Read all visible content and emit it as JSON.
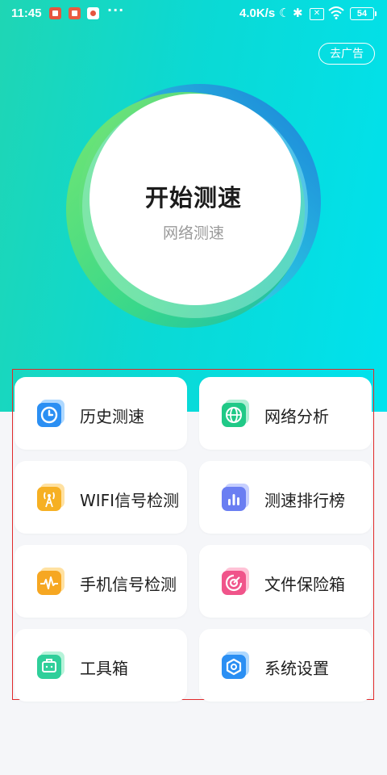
{
  "status_bar": {
    "time": "11:45",
    "dots": "···",
    "net_speed": "4.0K/s",
    "battery": "54"
  },
  "header": {
    "remove_ads": "去广告"
  },
  "speed_test": {
    "title": "开始测速",
    "subtitle": "网络测速"
  },
  "features": [
    {
      "label": "历史测速",
      "icon": "clock-icon",
      "color": "#2b8ff3"
    },
    {
      "label": "网络分析",
      "icon": "globe-icon",
      "color": "#20c987"
    },
    {
      "label": "WIFI信号检测",
      "icon": "signal-tower-icon",
      "color": "#f6b023"
    },
    {
      "label": "测速排行榜",
      "icon": "bar-chart-icon",
      "color": "#6a7ef2"
    },
    {
      "label": "手机信号检测",
      "icon": "pulse-icon",
      "color": "#f6a722"
    },
    {
      "label": "文件保险箱",
      "icon": "safe-icon",
      "color": "#f0548a"
    },
    {
      "label": "工具箱",
      "icon": "toolbox-icon",
      "color": "#2fcf9a"
    },
    {
      "label": "系统设置",
      "icon": "hex-settings-icon",
      "color": "#2b8ff3"
    }
  ],
  "colors": {
    "hero_start": "#1fd6b4",
    "hero_end": "#00e2ee",
    "highlight_frame": "#e12a2a"
  }
}
